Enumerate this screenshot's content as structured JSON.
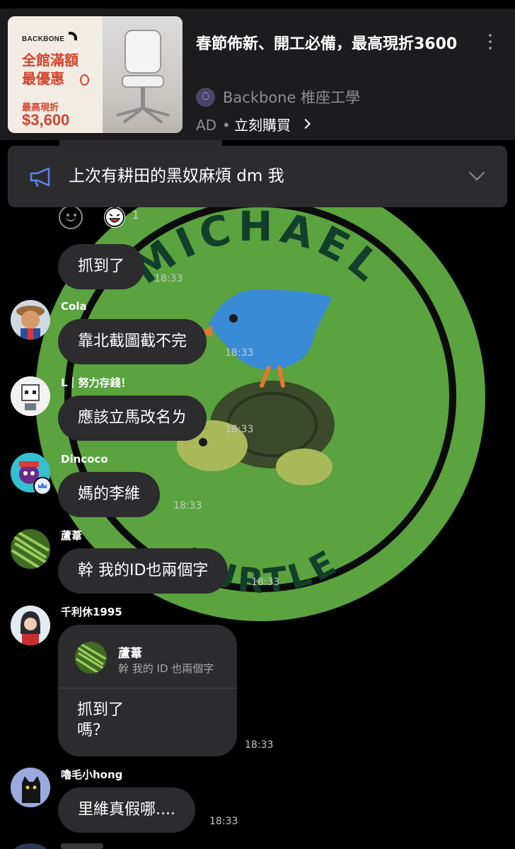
{
  "ad": {
    "thumbnail": {
      "brand": "BACKBONE",
      "promo_line1": "全館滿額",
      "promo_line2": "最優惠",
      "promo_line3": "最高現折",
      "promo_price": "$3,600"
    },
    "title": "春節佈新、開工必備，最高現折3600",
    "advertiser": "Backbone 椎座工學",
    "tag": "AD",
    "separator": "•",
    "cta": "立刻購買"
  },
  "announcement": {
    "text": "上次有耕田的黑奴麻煩 dm 我"
  },
  "reactions": {
    "count": "1"
  },
  "messages": [
    {
      "sender": "",
      "text": "抓到了",
      "time": "18:33"
    },
    {
      "sender": "Cola",
      "text": "靠北截圖截不完",
      "time": "18:33"
    },
    {
      "sender": "L｜努力存錢！",
      "text": "應該立馬改名ㄌ",
      "time": "18:33"
    },
    {
      "sender": "Dincoco",
      "text": "媽的李維",
      "time": "18:33"
    },
    {
      "sender": "蘆葦",
      "text": "幹 我的ID也兩個字",
      "time": "18:33"
    },
    {
      "sender": "千利休1995",
      "reply_to": {
        "name": "蘆葦",
        "text": "幹 我的 ID 也兩個字"
      },
      "text_line1": "抓到了",
      "text_line2": "嗎？",
      "time": "18:33"
    },
    {
      "sender": "嚕毛小hong",
      "text": "里維真假哪....",
      "time": "18:33"
    }
  ],
  "background": {
    "logo_top_text": "MICHAEL",
    "logo_bottom_text": "TURTLE",
    "colors": {
      "ring": "#5aa33f",
      "dark_text": "#123f2a",
      "bird": "#3a8bd6",
      "turtle_shell": "#3b4a2a"
    }
  },
  "colors": {
    "background": "#000000",
    "bubble": "#2c2c2e",
    "ad_background": "#1c1c1e",
    "secondary_text": "#8e8e93",
    "promo_red": "#d2452c"
  }
}
